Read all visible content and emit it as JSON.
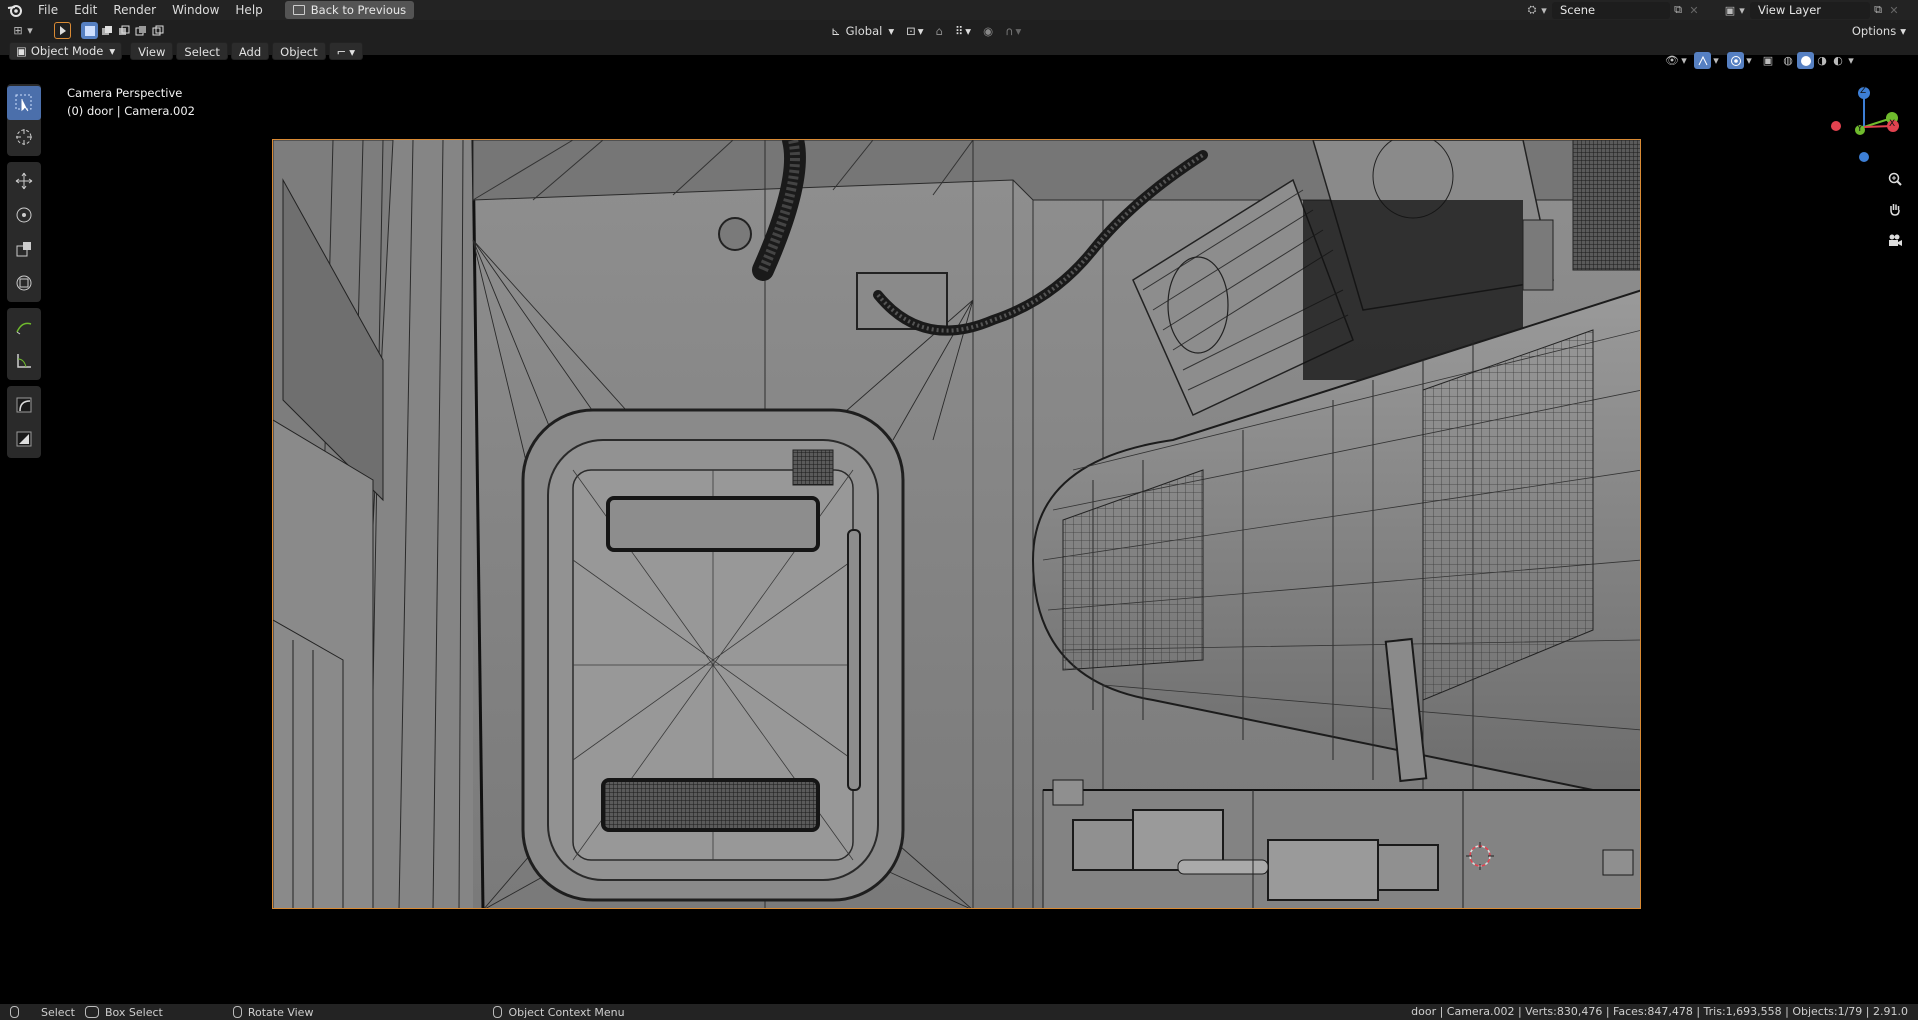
{
  "menu": {
    "items": [
      "File",
      "Edit",
      "Render",
      "Window",
      "Help"
    ],
    "back_button": "Back to Previous"
  },
  "scene": {
    "label": "Scene"
  },
  "view_layer": {
    "label": "View Layer"
  },
  "header": {
    "transform_orientation": "Global",
    "options_label": "Options",
    "mode": "Object Mode",
    "view_label": "View",
    "select_label": "Select",
    "add_label": "Add",
    "object_label": "Object"
  },
  "viewport": {
    "perspective_label": "Camera Perspective",
    "object_info": "(0) door | Camera.002"
  },
  "gizmo": {
    "z": "Z",
    "y": "Y",
    "x": "X"
  },
  "statusbar": {
    "select": "Select",
    "box_select": "Box Select",
    "rotate_view": "Rotate View",
    "context_menu": "Object Context Menu",
    "stats": "door | Camera.002 | Verts:830,476 | Faces:847,478 | Tris:1,693,558 | Objects:1/79 | 2.91.0"
  },
  "colors": {
    "accent": "#5680c2",
    "camera_border": "#d98a34",
    "axis_x": "#e2424f",
    "axis_y": "#6fbb2d",
    "axis_z": "#3d7fd6"
  }
}
